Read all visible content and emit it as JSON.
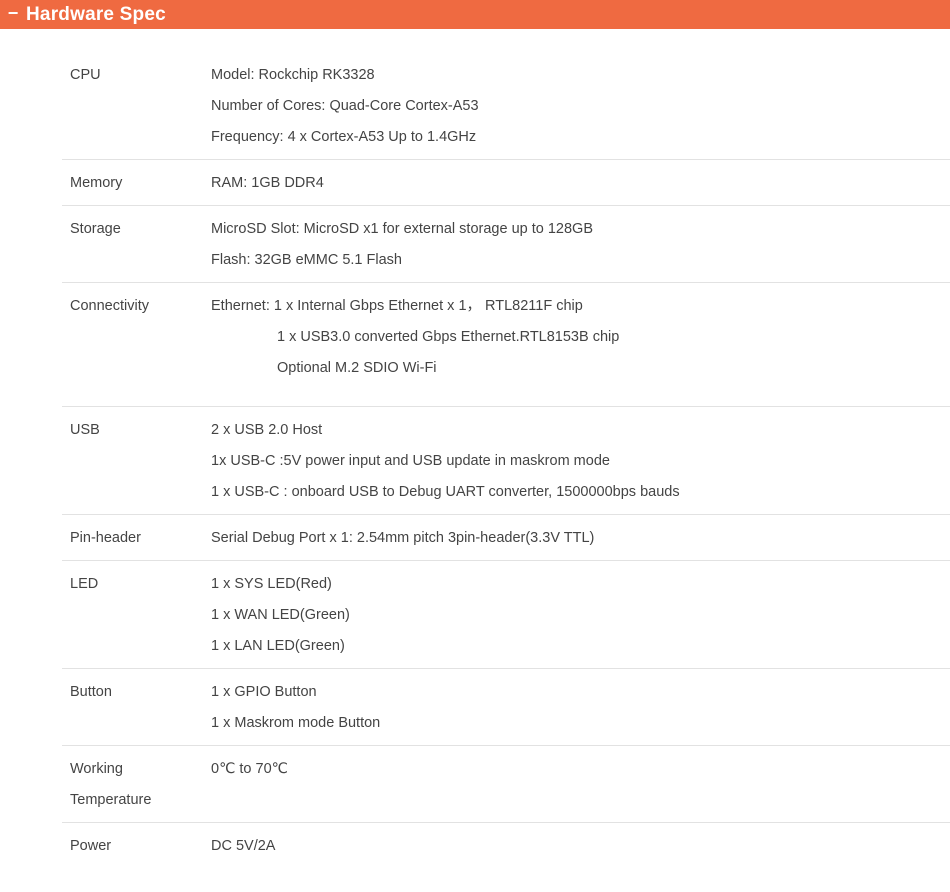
{
  "section": {
    "toggle_symbol": "−",
    "title": "Hardware Spec",
    "header_color": "#ef6a41"
  },
  "specs": [
    {
      "label": "CPU",
      "lines": [
        "Model: Rockchip RK3328",
        "Number of Cores: Quad-Core Cortex-A53",
        "Frequency: 4 x Cortex-A53 Up to 1.4GHz"
      ]
    },
    {
      "label": "Memory",
      "lines": [
        "RAM: 1GB DDR4"
      ]
    },
    {
      "label": "Storage",
      "lines": [
        "MicroSD Slot: MicroSD x1 for external storage up to 128GB",
        "Flash: 32GB eMMC 5.1 Flash"
      ]
    },
    {
      "label": "Connectivity",
      "lines": [
        "Ethernet: 1 x Internal Gbps Ethernet x 1， RTL8211F chip",
        "1 x USB3.0 converted Gbps Ethernet.RTL8153B chip",
        "Optional M.2 SDIO Wi-Fi"
      ]
    },
    {
      "label": "USB",
      "lines": [
        "2 x USB 2.0 Host",
        "1x USB-C :5V power input and USB update in maskrom mode",
        "1 x USB-C : onboard USB to Debug UART converter, 1500000bps bauds"
      ]
    },
    {
      "label": "Pin-header",
      "lines": [
        "Serial Debug Port x 1: 2.54mm pitch 3pin-header(3.3V TTL)"
      ]
    },
    {
      "label": "LED",
      "lines": [
        "1 x SYS LED(Red)",
        "1 x WAN LED(Green)",
        "1 x LAN LED(Green)"
      ]
    },
    {
      "label": "Button",
      "lines": [
        "1 x GPIO Button",
        "1 x Maskrom mode Button"
      ]
    },
    {
      "label_lines": [
        "Working",
        "Temperature"
      ],
      "lines": [
        "0℃ to 70℃"
      ]
    },
    {
      "label": "Power",
      "lines": [
        "DC 5V/2A"
      ]
    }
  ]
}
